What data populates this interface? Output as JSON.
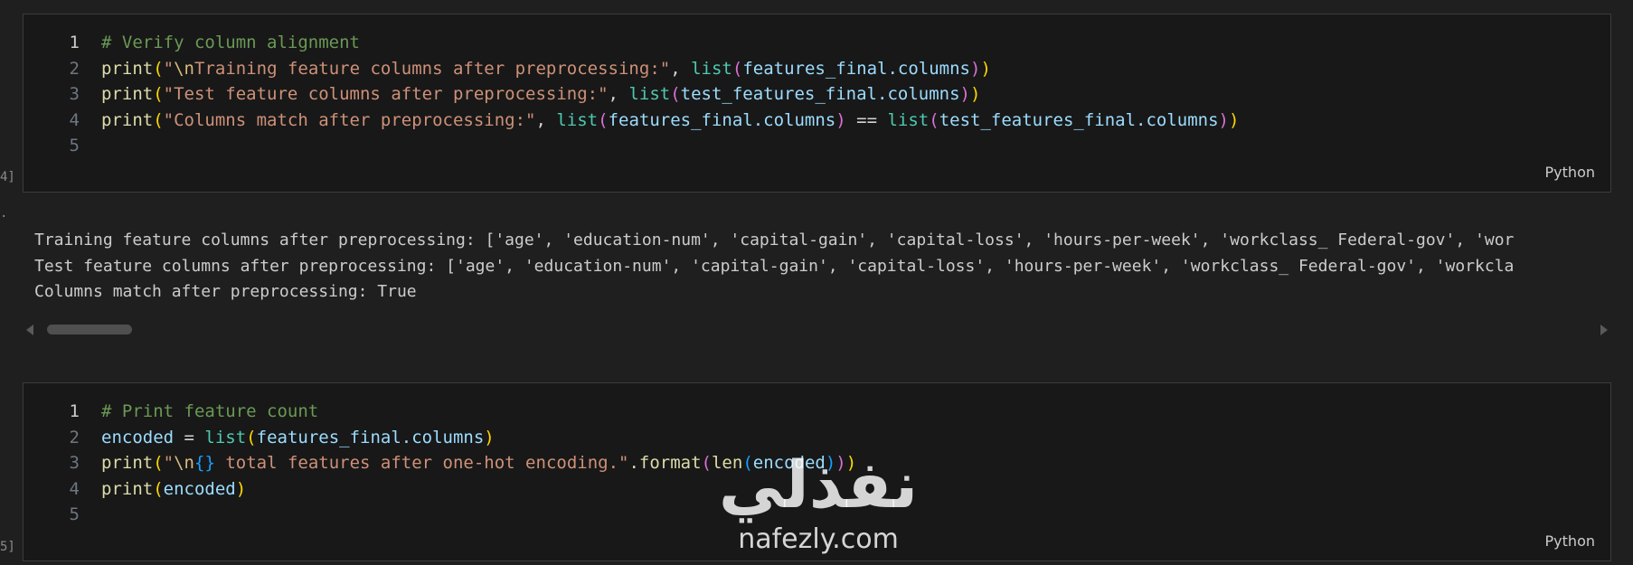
{
  "cells": [
    {
      "exec_count": "4]",
      "language": "Python",
      "lines": [
        {
          "n": "1",
          "tokens": [
            {
              "t": "# Verify column alignment",
              "c": "cmt"
            }
          ]
        },
        {
          "n": "2",
          "tokens": [
            {
              "t": "print",
              "c": "fn"
            },
            {
              "t": "(",
              "c": "p1"
            },
            {
              "t": "\"",
              "c": "str"
            },
            {
              "t": "\\n",
              "c": "esc"
            },
            {
              "t": "Training feature columns after preprocessing:\"",
              "c": "str"
            },
            {
              "t": ", ",
              "c": "op"
            },
            {
              "t": "list",
              "c": "cls"
            },
            {
              "t": "(",
              "c": "p2"
            },
            {
              "t": "features_final",
              "c": "var"
            },
            {
              "t": ".columns",
              "c": "var"
            },
            {
              "t": ")",
              "c": "p2"
            },
            {
              "t": ")",
              "c": "p1"
            }
          ]
        },
        {
          "n": "3",
          "tokens": [
            {
              "t": "print",
              "c": "fn"
            },
            {
              "t": "(",
              "c": "p1"
            },
            {
              "t": "\"Test feature columns after preprocessing:\"",
              "c": "str"
            },
            {
              "t": ", ",
              "c": "op"
            },
            {
              "t": "list",
              "c": "cls"
            },
            {
              "t": "(",
              "c": "p2"
            },
            {
              "t": "test_features_final",
              "c": "var"
            },
            {
              "t": ".columns",
              "c": "var"
            },
            {
              "t": ")",
              "c": "p2"
            },
            {
              "t": ")",
              "c": "p1"
            }
          ]
        },
        {
          "n": "4",
          "tokens": [
            {
              "t": "print",
              "c": "fn"
            },
            {
              "t": "(",
              "c": "p1"
            },
            {
              "t": "\"Columns match after preprocessing:\"",
              "c": "str"
            },
            {
              "t": ", ",
              "c": "op"
            },
            {
              "t": "list",
              "c": "cls"
            },
            {
              "t": "(",
              "c": "p2"
            },
            {
              "t": "features_final",
              "c": "var"
            },
            {
              "t": ".columns",
              "c": "var"
            },
            {
              "t": ")",
              "c": "p2"
            },
            {
              "t": " == ",
              "c": "op"
            },
            {
              "t": "list",
              "c": "cls"
            },
            {
              "t": "(",
              "c": "p2"
            },
            {
              "t": "test_features_final",
              "c": "var"
            },
            {
              "t": ".columns",
              "c": "var"
            },
            {
              "t": ")",
              "c": "p2"
            },
            {
              "t": ")",
              "c": "p1"
            }
          ]
        },
        {
          "n": "5",
          "tokens": []
        }
      ]
    },
    {
      "exec_count": "5]",
      "language": "Python",
      "lines": [
        {
          "n": "1",
          "tokens": [
            {
              "t": "# Print feature count",
              "c": "cmt"
            }
          ]
        },
        {
          "n": "2",
          "tokens": [
            {
              "t": "encoded",
              "c": "var"
            },
            {
              "t": " = ",
              "c": "op"
            },
            {
              "t": "list",
              "c": "cls"
            },
            {
              "t": "(",
              "c": "p1"
            },
            {
              "t": "features_final",
              "c": "var"
            },
            {
              "t": ".columns",
              "c": "var"
            },
            {
              "t": ")",
              "c": "p1"
            }
          ]
        },
        {
          "n": "3",
          "tokens": [
            {
              "t": "print",
              "c": "fn"
            },
            {
              "t": "(",
              "c": "p1"
            },
            {
              "t": "\"",
              "c": "str"
            },
            {
              "t": "\\n",
              "c": "esc"
            },
            {
              "t": "{}",
              "c": "p3"
            },
            {
              "t": " total features after one-hot encoding.\"",
              "c": "str"
            },
            {
              "t": ".format",
              "c": "fn"
            },
            {
              "t": "(",
              "c": "p2"
            },
            {
              "t": "len",
              "c": "fn"
            },
            {
              "t": "(",
              "c": "p3"
            },
            {
              "t": "encoded",
              "c": "var"
            },
            {
              "t": ")",
              "c": "p3"
            },
            {
              "t": ")",
              "c": "p2"
            },
            {
              "t": ")",
              "c": "p1"
            }
          ]
        },
        {
          "n": "4",
          "tokens": [
            {
              "t": "print",
              "c": "fn"
            },
            {
              "t": "(",
              "c": "p1"
            },
            {
              "t": "encoded",
              "c": "var"
            },
            {
              "t": ")",
              "c": "p1"
            }
          ]
        },
        {
          "n": "5",
          "tokens": []
        }
      ]
    }
  ],
  "output": {
    "marker": "·",
    "lines": [
      "Training feature columns after preprocessing: ['age', 'education-num', 'capital-gain', 'capital-loss', 'hours-per-week', 'workclass_ Federal-gov', 'wor",
      "Test feature columns after preprocessing: ['age', 'education-num', 'capital-gain', 'capital-loss', 'hours-per-week', 'workclass_ Federal-gov', 'workcla",
      "Columns match after preprocessing: True"
    ]
  },
  "watermark": {
    "logo_text": "نفذلي",
    "url": "nafezly.com"
  },
  "colors": {
    "background": "#1f1f1f",
    "cell_background": "#181818",
    "comment": "#6a9955",
    "function": "#dcdcaa",
    "string": "#ce9178",
    "variable": "#9cdcfe",
    "builtin": "#4ec9b0",
    "bracket_1": "#ffd700",
    "bracket_2": "#da70d6",
    "bracket_3": "#179fff"
  }
}
